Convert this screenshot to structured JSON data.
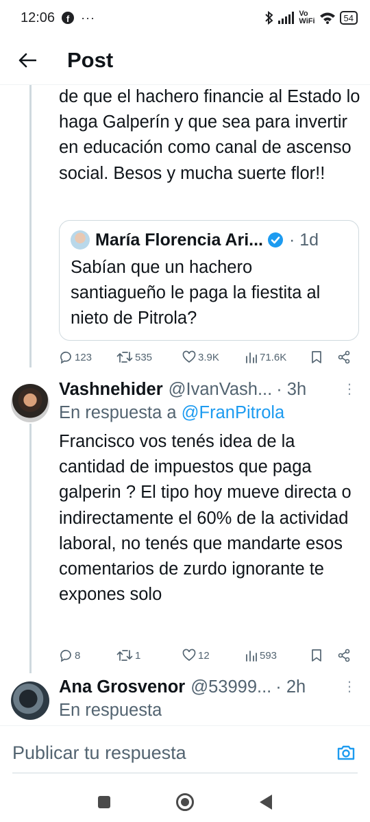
{
  "status_bar": {
    "time": "12:06",
    "notif_dots": "···",
    "vowifi_top": "Vo",
    "vowifi_bottom": "WiFi",
    "battery": "54"
  },
  "header": {
    "title": "Post"
  },
  "tweet1": {
    "text": "de que el hachero financie al Estado lo haga Galperín y que sea para invertir en educación como canal de ascenso social. Besos y mucha suerte flor!!",
    "quote": {
      "name": "María Florencia Ari...",
      "time": "· 1d",
      "text": "Sabían que un hachero santiagueño le paga la fiestita al nieto de Pitrola?"
    },
    "actions": {
      "replies": "123",
      "retweets": "535",
      "likes": "3.9K",
      "views": "71.6K"
    }
  },
  "tweet2": {
    "name": "Vashnehider",
    "handle": "@IvanVash...",
    "time": "· 3h",
    "reply_prefix": "En respuesta a",
    "reply_handle": "@FranPitrola",
    "text": "Francisco vos tenés idea de la cantidad de impuestos que paga galperin ? El tipo hoy mueve directa o indirectamente el 60% de la actividad laboral, no tenés que mandarte esos comentarios de zurdo ignorante te expones solo",
    "actions": {
      "replies": "8",
      "retweets": "1",
      "likes": "12",
      "views": "593"
    }
  },
  "tweet3": {
    "name": "Ana Grosvenor",
    "handle": "@53999...",
    "time": "· 2h",
    "reply_prefix": "En respuesta"
  },
  "composer": {
    "placeholder": "Publicar tu respuesta"
  },
  "colors": {
    "accent": "#1d9bf0",
    "text": "#0f1419",
    "muted": "#536471"
  }
}
